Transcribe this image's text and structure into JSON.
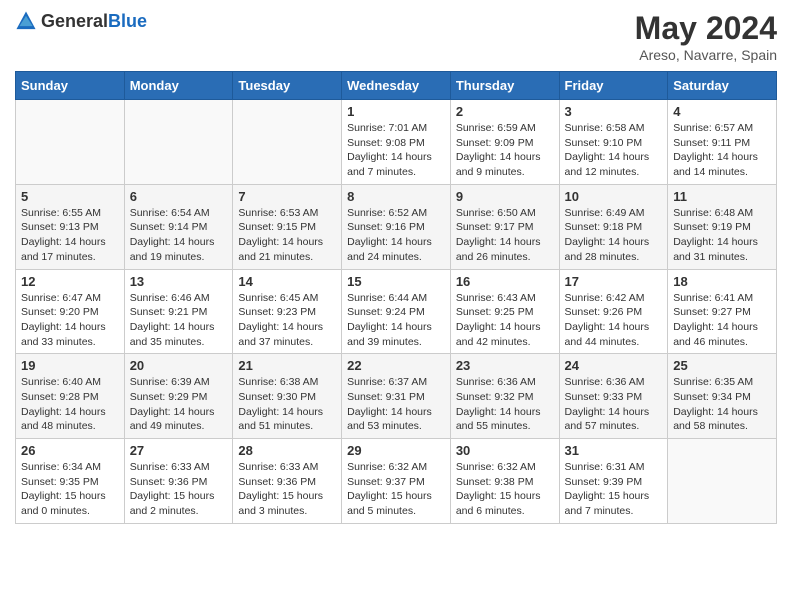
{
  "header": {
    "logo_general": "General",
    "logo_blue": "Blue",
    "month_year": "May 2024",
    "location": "Areso, Navarre, Spain"
  },
  "days_of_week": [
    "Sunday",
    "Monday",
    "Tuesday",
    "Wednesday",
    "Thursday",
    "Friday",
    "Saturday"
  ],
  "weeks": [
    [
      {
        "day": "",
        "info": ""
      },
      {
        "day": "",
        "info": ""
      },
      {
        "day": "",
        "info": ""
      },
      {
        "day": "1",
        "info": "Sunrise: 7:01 AM\nSunset: 9:08 PM\nDaylight: 14 hours\nand 7 minutes."
      },
      {
        "day": "2",
        "info": "Sunrise: 6:59 AM\nSunset: 9:09 PM\nDaylight: 14 hours\nand 9 minutes."
      },
      {
        "day": "3",
        "info": "Sunrise: 6:58 AM\nSunset: 9:10 PM\nDaylight: 14 hours\nand 12 minutes."
      },
      {
        "day": "4",
        "info": "Sunrise: 6:57 AM\nSunset: 9:11 PM\nDaylight: 14 hours\nand 14 minutes."
      }
    ],
    [
      {
        "day": "5",
        "info": "Sunrise: 6:55 AM\nSunset: 9:13 PM\nDaylight: 14 hours\nand 17 minutes."
      },
      {
        "day": "6",
        "info": "Sunrise: 6:54 AM\nSunset: 9:14 PM\nDaylight: 14 hours\nand 19 minutes."
      },
      {
        "day": "7",
        "info": "Sunrise: 6:53 AM\nSunset: 9:15 PM\nDaylight: 14 hours\nand 21 minutes."
      },
      {
        "day": "8",
        "info": "Sunrise: 6:52 AM\nSunset: 9:16 PM\nDaylight: 14 hours\nand 24 minutes."
      },
      {
        "day": "9",
        "info": "Sunrise: 6:50 AM\nSunset: 9:17 PM\nDaylight: 14 hours\nand 26 minutes."
      },
      {
        "day": "10",
        "info": "Sunrise: 6:49 AM\nSunset: 9:18 PM\nDaylight: 14 hours\nand 28 minutes."
      },
      {
        "day": "11",
        "info": "Sunrise: 6:48 AM\nSunset: 9:19 PM\nDaylight: 14 hours\nand 31 minutes."
      }
    ],
    [
      {
        "day": "12",
        "info": "Sunrise: 6:47 AM\nSunset: 9:20 PM\nDaylight: 14 hours\nand 33 minutes."
      },
      {
        "day": "13",
        "info": "Sunrise: 6:46 AM\nSunset: 9:21 PM\nDaylight: 14 hours\nand 35 minutes."
      },
      {
        "day": "14",
        "info": "Sunrise: 6:45 AM\nSunset: 9:23 PM\nDaylight: 14 hours\nand 37 minutes."
      },
      {
        "day": "15",
        "info": "Sunrise: 6:44 AM\nSunset: 9:24 PM\nDaylight: 14 hours\nand 39 minutes."
      },
      {
        "day": "16",
        "info": "Sunrise: 6:43 AM\nSunset: 9:25 PM\nDaylight: 14 hours\nand 42 minutes."
      },
      {
        "day": "17",
        "info": "Sunrise: 6:42 AM\nSunset: 9:26 PM\nDaylight: 14 hours\nand 44 minutes."
      },
      {
        "day": "18",
        "info": "Sunrise: 6:41 AM\nSunset: 9:27 PM\nDaylight: 14 hours\nand 46 minutes."
      }
    ],
    [
      {
        "day": "19",
        "info": "Sunrise: 6:40 AM\nSunset: 9:28 PM\nDaylight: 14 hours\nand 48 minutes."
      },
      {
        "day": "20",
        "info": "Sunrise: 6:39 AM\nSunset: 9:29 PM\nDaylight: 14 hours\nand 49 minutes."
      },
      {
        "day": "21",
        "info": "Sunrise: 6:38 AM\nSunset: 9:30 PM\nDaylight: 14 hours\nand 51 minutes."
      },
      {
        "day": "22",
        "info": "Sunrise: 6:37 AM\nSunset: 9:31 PM\nDaylight: 14 hours\nand 53 minutes."
      },
      {
        "day": "23",
        "info": "Sunrise: 6:36 AM\nSunset: 9:32 PM\nDaylight: 14 hours\nand 55 minutes."
      },
      {
        "day": "24",
        "info": "Sunrise: 6:36 AM\nSunset: 9:33 PM\nDaylight: 14 hours\nand 57 minutes."
      },
      {
        "day": "25",
        "info": "Sunrise: 6:35 AM\nSunset: 9:34 PM\nDaylight: 14 hours\nand 58 minutes."
      }
    ],
    [
      {
        "day": "26",
        "info": "Sunrise: 6:34 AM\nSunset: 9:35 PM\nDaylight: 15 hours\nand 0 minutes."
      },
      {
        "day": "27",
        "info": "Sunrise: 6:33 AM\nSunset: 9:36 PM\nDaylight: 15 hours\nand 2 minutes."
      },
      {
        "day": "28",
        "info": "Sunrise: 6:33 AM\nSunset: 9:36 PM\nDaylight: 15 hours\nand 3 minutes."
      },
      {
        "day": "29",
        "info": "Sunrise: 6:32 AM\nSunset: 9:37 PM\nDaylight: 15 hours\nand 5 minutes."
      },
      {
        "day": "30",
        "info": "Sunrise: 6:32 AM\nSunset: 9:38 PM\nDaylight: 15 hours\nand 6 minutes."
      },
      {
        "day": "31",
        "info": "Sunrise: 6:31 AM\nSunset: 9:39 PM\nDaylight: 15 hours\nand 7 minutes."
      },
      {
        "day": "",
        "info": ""
      }
    ]
  ]
}
